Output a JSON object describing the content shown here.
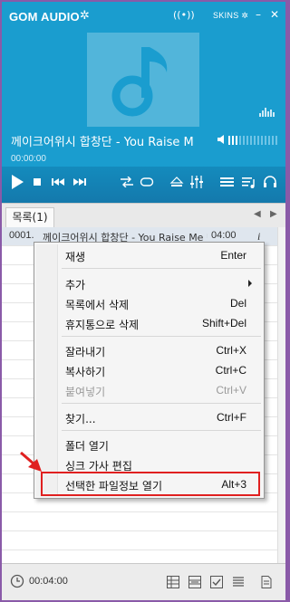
{
  "window": {
    "title": "GOM AUDIO",
    "skins_label": "SKINS",
    "minimize_glyph": "–",
    "close_glyph": "✕"
  },
  "player": {
    "track_title": "께이크어위시 합창단 - You Raise M",
    "current_time": "00:00:00",
    "volume_level": 0.2,
    "seek_progress": 0.0
  },
  "playlist": {
    "tab_label": "목록(1)",
    "items": [
      {
        "index": "0001.",
        "title": "께이크어위시 합창단 - You Raise Me Up",
        "duration": "04:00",
        "info_glyph": "i"
      }
    ],
    "total_time": "00:04:00"
  },
  "context_menu": {
    "items": [
      {
        "label": "재생",
        "shortcut": "Enter"
      },
      {
        "label": "추가",
        "shortcut": ""
      },
      {
        "label": "목록에서 삭제",
        "shortcut": "Del"
      },
      {
        "label": "휴지통으로 삭제",
        "shortcut": "Shift+Del"
      },
      {
        "label": "잘라내기",
        "shortcut": "Ctrl+X"
      },
      {
        "label": "복사하기",
        "shortcut": "Ctrl+C"
      },
      {
        "label": "붙여넣기",
        "shortcut": "Ctrl+V"
      },
      {
        "label": "찾기...",
        "shortcut": "Ctrl+F"
      },
      {
        "label": "폴더 열기",
        "shortcut": ""
      },
      {
        "label": "싱크 가사 편집",
        "shortcut": ""
      },
      {
        "label": "선택한 파일정보 열기",
        "shortcut": "Alt+3"
      }
    ]
  },
  "colors": {
    "player_bg": "#1a9dcf",
    "album_bg": "#52b5da",
    "annotation_red": "#e02020"
  }
}
